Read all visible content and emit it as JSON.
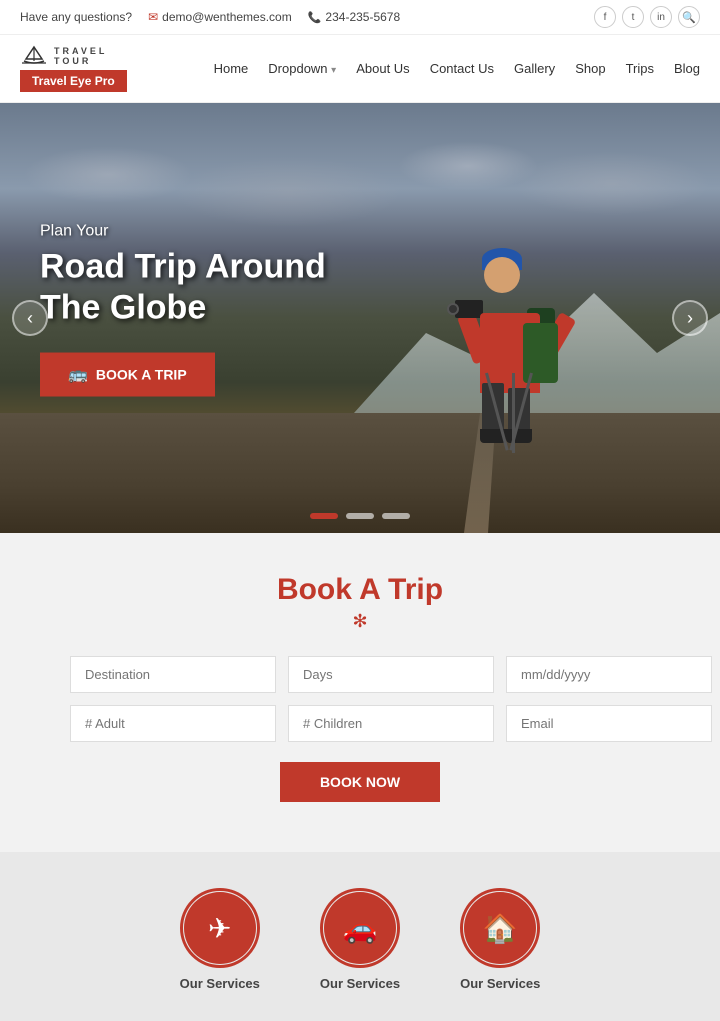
{
  "topbar": {
    "question": "Have any questions?",
    "email": "demo@wenthemes.com",
    "phone": "234-235-5678",
    "social": [
      "f",
      "t",
      "in"
    ],
    "search_placeholder": "Search"
  },
  "navbar": {
    "brand_text_top": "TRAVEL",
    "brand_text_bottom": "TOUR",
    "logo_button": "Travel Eye Pro",
    "links": [
      {
        "label": "Home",
        "active": false
      },
      {
        "label": "Dropdown",
        "dropdown": true,
        "active": false
      },
      {
        "label": "About Us",
        "active": false
      },
      {
        "label": "Contact Us",
        "active": false
      },
      {
        "label": "Gallery",
        "active": false
      },
      {
        "label": "Shop",
        "active": false
      },
      {
        "label": "Trips",
        "active": false
      },
      {
        "label": "Blog",
        "active": false
      }
    ]
  },
  "hero": {
    "pre_title": "Plan Your",
    "title_line1": "Road Trip Around",
    "title_line2": "The Globe",
    "book_btn": "Book A Trip",
    "dots": [
      "active",
      "inactive",
      "inactive"
    ],
    "arrow_left": "‹",
    "arrow_right": "›"
  },
  "book_section": {
    "title_plain": "ook A Trip",
    "title_colored": "B",
    "divider": "✻",
    "form": {
      "destination_placeholder": "Destination",
      "days_placeholder": "Days",
      "date_placeholder": "mm/dd/yyyy",
      "adults_placeholder": "# Adult",
      "children_placeholder": "# Children",
      "email_placeholder": "Email",
      "button": "Book Now"
    }
  },
  "services": [
    {
      "icon": "✈",
      "label": "Our Services"
    },
    {
      "icon": "🚗",
      "label": "Our Services"
    },
    {
      "icon": "🏠",
      "label": "Our Services"
    }
  ]
}
